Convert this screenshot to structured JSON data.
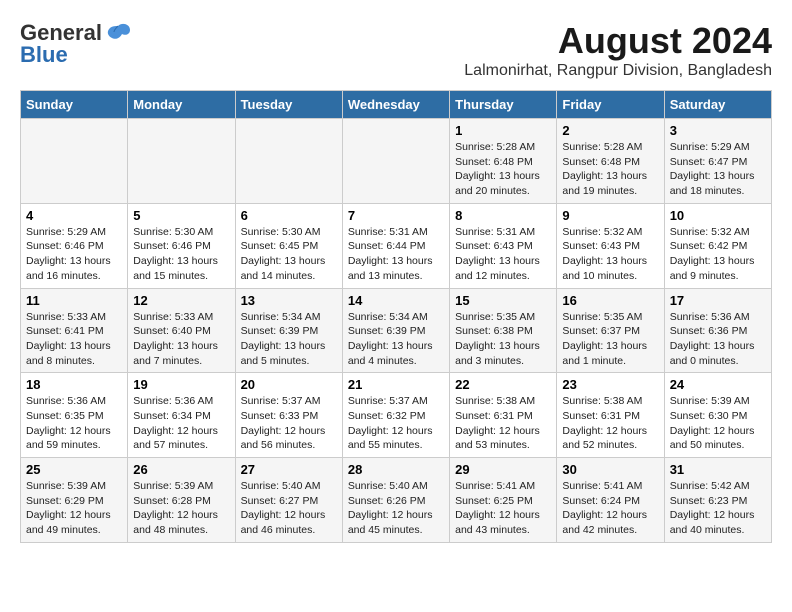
{
  "logo": {
    "general": "General",
    "blue": "Blue"
  },
  "title": "August 2024",
  "subtitle": "Lalmonirhat, Rangpur Division, Bangladesh",
  "headers": [
    "Sunday",
    "Monday",
    "Tuesday",
    "Wednesday",
    "Thursday",
    "Friday",
    "Saturday"
  ],
  "weeks": [
    [
      {
        "day": "",
        "detail": ""
      },
      {
        "day": "",
        "detail": ""
      },
      {
        "day": "",
        "detail": ""
      },
      {
        "day": "",
        "detail": ""
      },
      {
        "day": "1",
        "detail": "Sunrise: 5:28 AM\nSunset: 6:48 PM\nDaylight: 13 hours\nand 20 minutes."
      },
      {
        "day": "2",
        "detail": "Sunrise: 5:28 AM\nSunset: 6:48 PM\nDaylight: 13 hours\nand 19 minutes."
      },
      {
        "day": "3",
        "detail": "Sunrise: 5:29 AM\nSunset: 6:47 PM\nDaylight: 13 hours\nand 18 minutes."
      }
    ],
    [
      {
        "day": "4",
        "detail": "Sunrise: 5:29 AM\nSunset: 6:46 PM\nDaylight: 13 hours\nand 16 minutes."
      },
      {
        "day": "5",
        "detail": "Sunrise: 5:30 AM\nSunset: 6:46 PM\nDaylight: 13 hours\nand 15 minutes."
      },
      {
        "day": "6",
        "detail": "Sunrise: 5:30 AM\nSunset: 6:45 PM\nDaylight: 13 hours\nand 14 minutes."
      },
      {
        "day": "7",
        "detail": "Sunrise: 5:31 AM\nSunset: 6:44 PM\nDaylight: 13 hours\nand 13 minutes."
      },
      {
        "day": "8",
        "detail": "Sunrise: 5:31 AM\nSunset: 6:43 PM\nDaylight: 13 hours\nand 12 minutes."
      },
      {
        "day": "9",
        "detail": "Sunrise: 5:32 AM\nSunset: 6:43 PM\nDaylight: 13 hours\nand 10 minutes."
      },
      {
        "day": "10",
        "detail": "Sunrise: 5:32 AM\nSunset: 6:42 PM\nDaylight: 13 hours\nand 9 minutes."
      }
    ],
    [
      {
        "day": "11",
        "detail": "Sunrise: 5:33 AM\nSunset: 6:41 PM\nDaylight: 13 hours\nand 8 minutes."
      },
      {
        "day": "12",
        "detail": "Sunrise: 5:33 AM\nSunset: 6:40 PM\nDaylight: 13 hours\nand 7 minutes."
      },
      {
        "day": "13",
        "detail": "Sunrise: 5:34 AM\nSunset: 6:39 PM\nDaylight: 13 hours\nand 5 minutes."
      },
      {
        "day": "14",
        "detail": "Sunrise: 5:34 AM\nSunset: 6:39 PM\nDaylight: 13 hours\nand 4 minutes."
      },
      {
        "day": "15",
        "detail": "Sunrise: 5:35 AM\nSunset: 6:38 PM\nDaylight: 13 hours\nand 3 minutes."
      },
      {
        "day": "16",
        "detail": "Sunrise: 5:35 AM\nSunset: 6:37 PM\nDaylight: 13 hours\nand 1 minute."
      },
      {
        "day": "17",
        "detail": "Sunrise: 5:36 AM\nSunset: 6:36 PM\nDaylight: 13 hours\nand 0 minutes."
      }
    ],
    [
      {
        "day": "18",
        "detail": "Sunrise: 5:36 AM\nSunset: 6:35 PM\nDaylight: 12 hours\nand 59 minutes."
      },
      {
        "day": "19",
        "detail": "Sunrise: 5:36 AM\nSunset: 6:34 PM\nDaylight: 12 hours\nand 57 minutes."
      },
      {
        "day": "20",
        "detail": "Sunrise: 5:37 AM\nSunset: 6:33 PM\nDaylight: 12 hours\nand 56 minutes."
      },
      {
        "day": "21",
        "detail": "Sunrise: 5:37 AM\nSunset: 6:32 PM\nDaylight: 12 hours\nand 55 minutes."
      },
      {
        "day": "22",
        "detail": "Sunrise: 5:38 AM\nSunset: 6:31 PM\nDaylight: 12 hours\nand 53 minutes."
      },
      {
        "day": "23",
        "detail": "Sunrise: 5:38 AM\nSunset: 6:31 PM\nDaylight: 12 hours\nand 52 minutes."
      },
      {
        "day": "24",
        "detail": "Sunrise: 5:39 AM\nSunset: 6:30 PM\nDaylight: 12 hours\nand 50 minutes."
      }
    ],
    [
      {
        "day": "25",
        "detail": "Sunrise: 5:39 AM\nSunset: 6:29 PM\nDaylight: 12 hours\nand 49 minutes."
      },
      {
        "day": "26",
        "detail": "Sunrise: 5:39 AM\nSunset: 6:28 PM\nDaylight: 12 hours\nand 48 minutes."
      },
      {
        "day": "27",
        "detail": "Sunrise: 5:40 AM\nSunset: 6:27 PM\nDaylight: 12 hours\nand 46 minutes."
      },
      {
        "day": "28",
        "detail": "Sunrise: 5:40 AM\nSunset: 6:26 PM\nDaylight: 12 hours\nand 45 minutes."
      },
      {
        "day": "29",
        "detail": "Sunrise: 5:41 AM\nSunset: 6:25 PM\nDaylight: 12 hours\nand 43 minutes."
      },
      {
        "day": "30",
        "detail": "Sunrise: 5:41 AM\nSunset: 6:24 PM\nDaylight: 12 hours\nand 42 minutes."
      },
      {
        "day": "31",
        "detail": "Sunrise: 5:42 AM\nSunset: 6:23 PM\nDaylight: 12 hours\nand 40 minutes."
      }
    ]
  ]
}
